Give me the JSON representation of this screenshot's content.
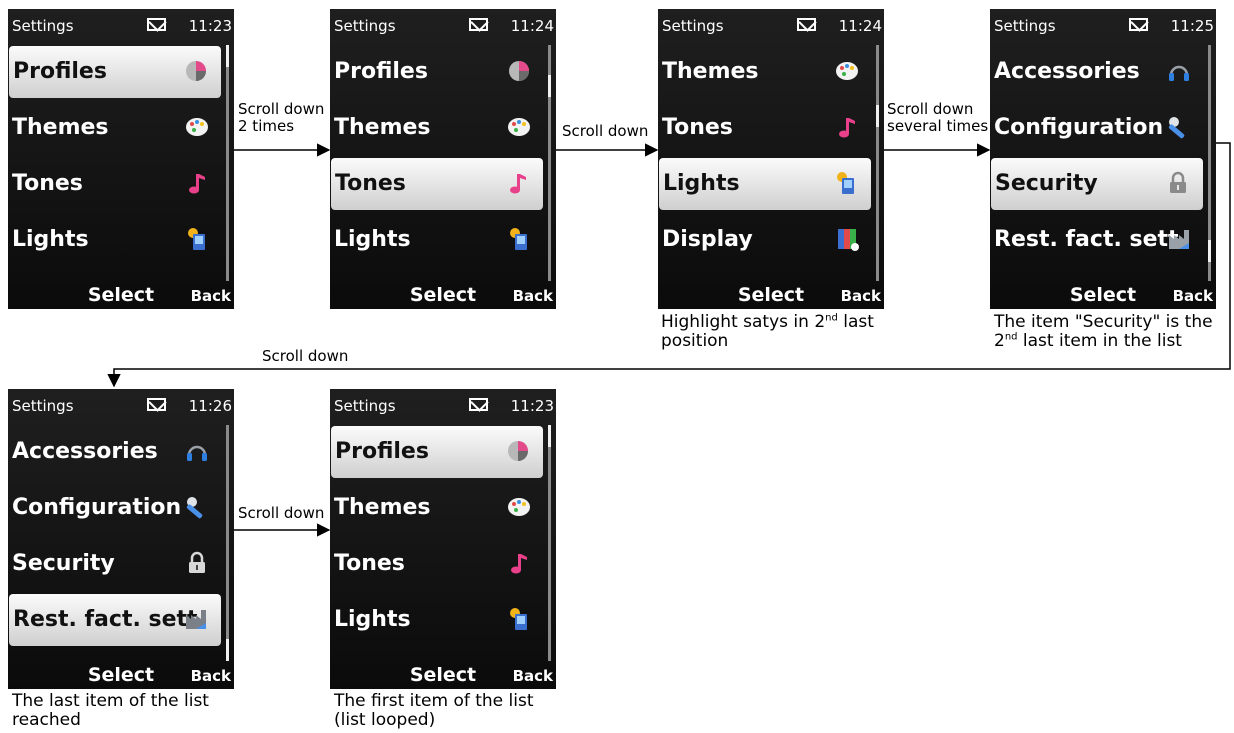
{
  "screens": [
    {
      "title": "Settings",
      "time": "11:23",
      "items": [
        {
          "label": "Profiles",
          "icon": "profiles-icon",
          "selected": true
        },
        {
          "label": "Themes",
          "icon": "themes-icon"
        },
        {
          "label": "Tones",
          "icon": "tones-icon"
        },
        {
          "label": "Lights",
          "icon": "lights-icon"
        }
      ],
      "softkeys": {
        "select": "Select",
        "back": "Back"
      }
    },
    {
      "title": "Settings",
      "time": "11:24",
      "items": [
        {
          "label": "Profiles",
          "icon": "profiles-icon"
        },
        {
          "label": "Themes",
          "icon": "themes-icon"
        },
        {
          "label": "Tones",
          "icon": "tones-icon",
          "selected": true
        },
        {
          "label": "Lights",
          "icon": "lights-icon"
        }
      ],
      "softkeys": {
        "select": "Select",
        "back": "Back"
      }
    },
    {
      "title": "Settings",
      "time": "11:24",
      "items": [
        {
          "label": "Themes",
          "icon": "themes-icon"
        },
        {
          "label": "Tones",
          "icon": "tones-icon"
        },
        {
          "label": "Lights",
          "icon": "lights-icon",
          "selected": true
        },
        {
          "label": "Display",
          "icon": "display-icon"
        }
      ],
      "softkeys": {
        "select": "Select",
        "back": "Back"
      }
    },
    {
      "title": "Settings",
      "time": "11:25",
      "items": [
        {
          "label": "Accessories",
          "icon": "accessories-icon"
        },
        {
          "label": "Configuration",
          "icon": "configuration-icon"
        },
        {
          "label": "Security",
          "icon": "security-icon",
          "selected": true
        },
        {
          "label": "Rest. fact. sett.",
          "icon": "restore-icon"
        }
      ],
      "softkeys": {
        "select": "Select",
        "back": "Back"
      }
    },
    {
      "title": "Settings",
      "time": "11:26",
      "items": [
        {
          "label": "Accessories",
          "icon": "accessories-icon"
        },
        {
          "label": "Configuration",
          "icon": "configuration-icon"
        },
        {
          "label": "Security",
          "icon": "security-icon"
        },
        {
          "label": "Rest. fact. sett.",
          "icon": "restore-icon",
          "selected": true
        }
      ],
      "softkeys": {
        "select": "Select",
        "back": "Back"
      }
    },
    {
      "title": "Settings",
      "time": "11:23",
      "items": [
        {
          "label": "Profiles",
          "icon": "profiles-icon",
          "selected": true
        },
        {
          "label": "Themes",
          "icon": "themes-icon"
        },
        {
          "label": "Tones",
          "icon": "tones-icon"
        },
        {
          "label": "Lights",
          "icon": "lights-icon"
        }
      ],
      "softkeys": {
        "select": "Select",
        "back": "Back"
      }
    }
  ],
  "transitions": [
    {
      "line1": "Scroll down",
      "line2": "2 times"
    },
    {
      "line1": "Scroll down",
      "line2": ""
    },
    {
      "line1": "Scroll down",
      "line2": "several times"
    },
    {
      "line1": "Scroll down",
      "line2": ""
    },
    {
      "line1": "Scroll down",
      "line2": ""
    }
  ],
  "captions": [
    {
      "l1a": "Highlight satys in 2",
      "l1sup": "nd",
      "l1b": " last",
      "l2a": "position",
      "l2sup": "",
      "l2b": ""
    },
    {
      "l1a": "The item \"Security\" is the",
      "l1sup": "",
      "l1b": "",
      "l2a": "2",
      "l2sup": "nd",
      "l2b": " last item in the list"
    },
    {
      "l1a": "The last item of the list",
      "l1sup": "",
      "l1b": "",
      "l2a": "reached",
      "l2sup": "",
      "l2b": ""
    },
    {
      "l1a": "The first item of the list",
      "l1sup": "",
      "l1b": "",
      "l2a": "(list looped)",
      "l2sup": "",
      "l2b": ""
    }
  ],
  "colors": {
    "tones": "#e8408a",
    "profiles": "#e24a8a",
    "lights": "#f2b31a",
    "display_blue": "#3a6fd0",
    "accessories": "#2f7fe0"
  }
}
